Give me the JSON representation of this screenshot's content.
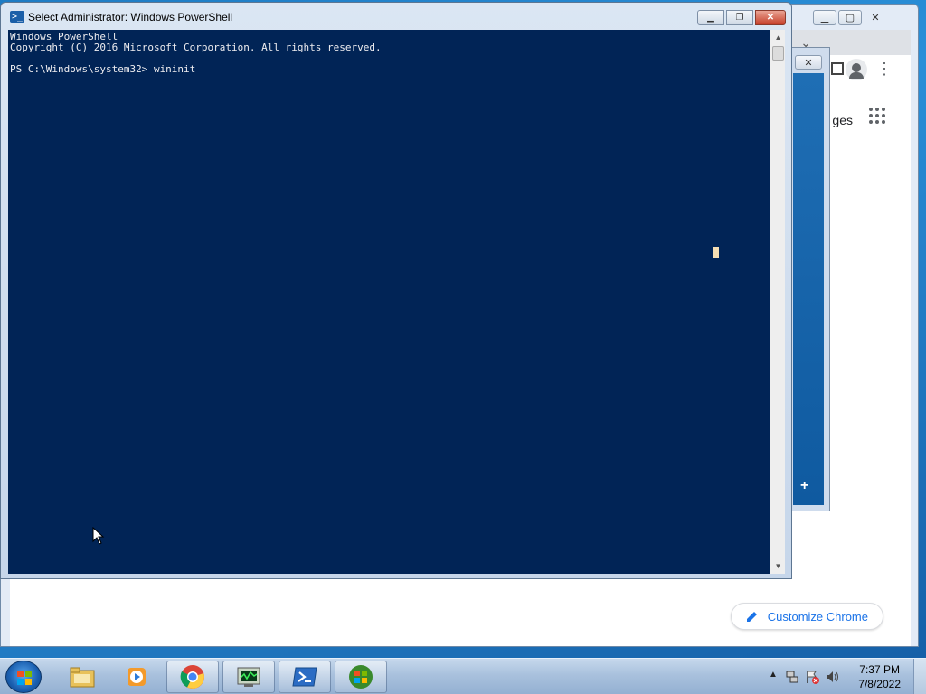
{
  "powershell": {
    "title": "Select Administrator: Windows PowerShell",
    "icon": "powershell-icon",
    "console_lines": [
      "Windows PowerShell",
      "Copyright (C) 2016 Microsoft Corporation. All rights reserved.",
      "",
      "PS C:\\Windows\\system32> wininit"
    ],
    "background_color": "#012456",
    "text_color": "#eeedf0"
  },
  "chrome": {
    "images_link": "ges",
    "customize_label": "Customize Chrome"
  },
  "taskbar": {
    "buttons": [
      {
        "name": "start-button",
        "icon": "windows-logo-icon"
      },
      {
        "name": "file-explorer",
        "icon": "folder-icon"
      },
      {
        "name": "media-player",
        "icon": "media-player-icon"
      },
      {
        "name": "chrome",
        "icon": "chrome-icon"
      },
      {
        "name": "task-manager",
        "icon": "task-manager-icon"
      },
      {
        "name": "powershell",
        "icon": "powershell-icon"
      },
      {
        "name": "windows-update",
        "icon": "windows-orb-icon"
      }
    ],
    "clock_time": "7:37 PM",
    "clock_date": "7/8/2022"
  }
}
